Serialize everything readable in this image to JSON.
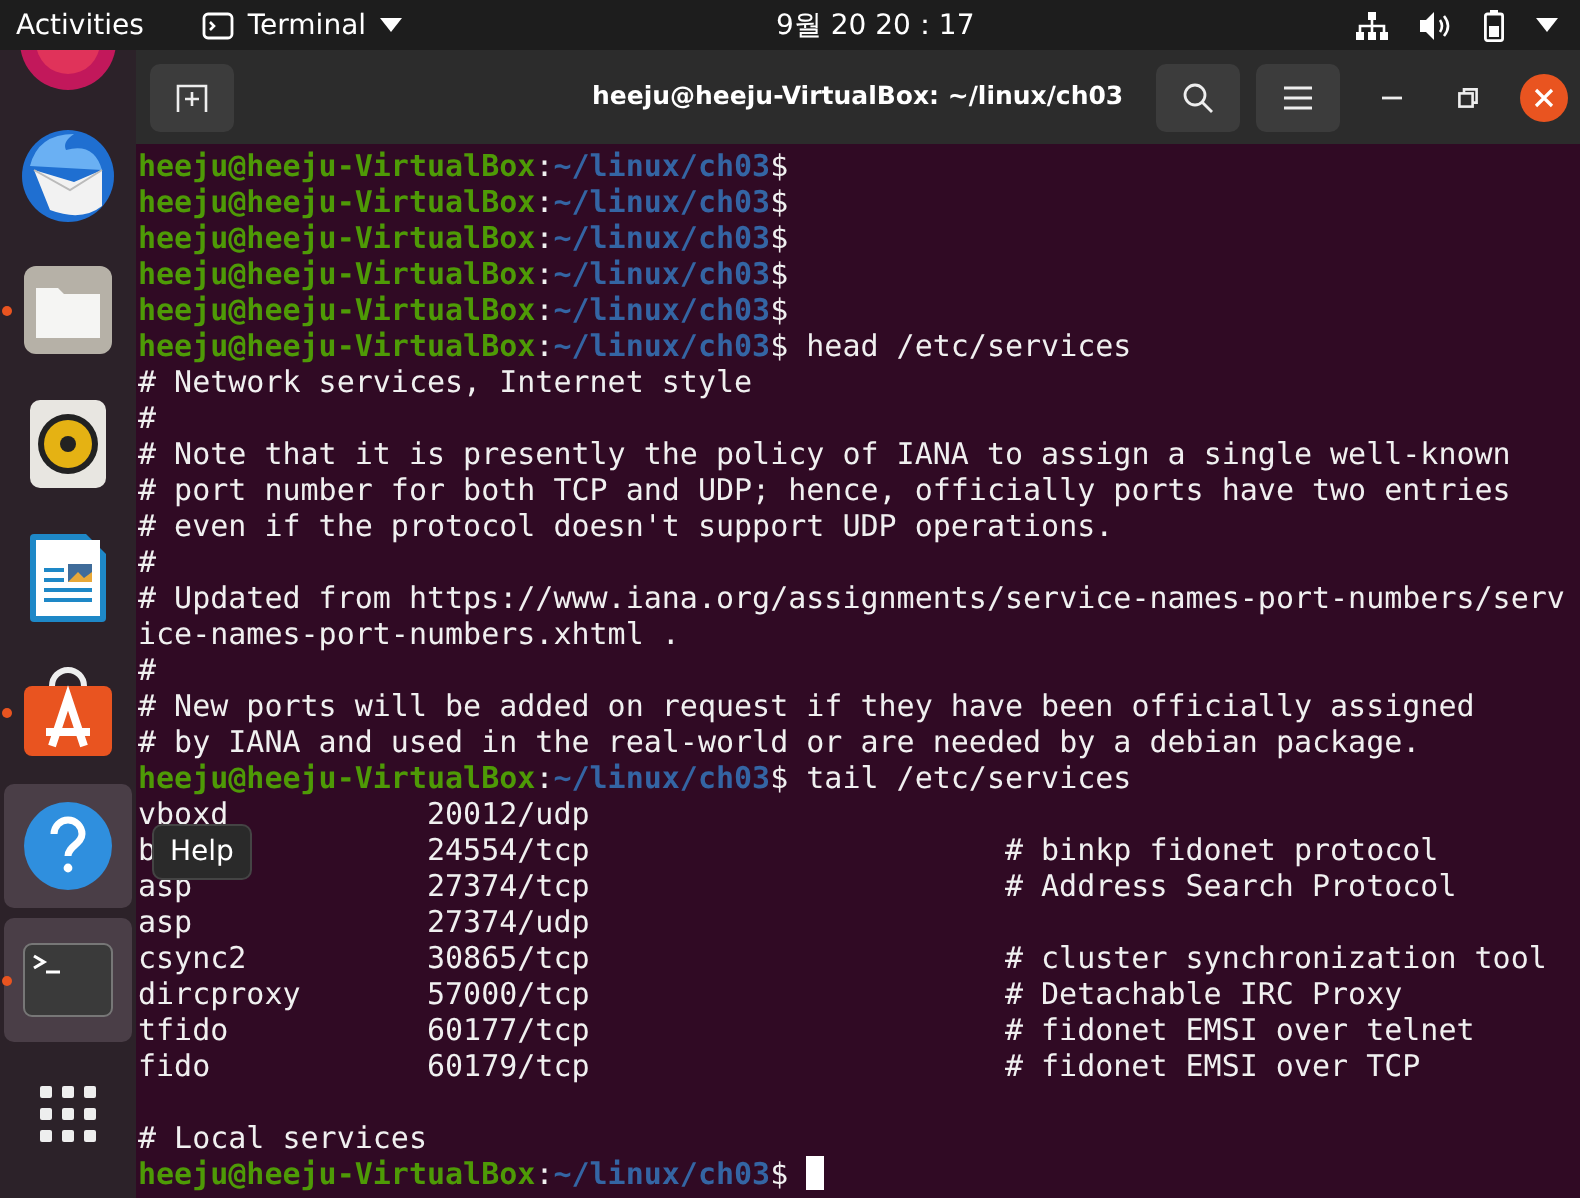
{
  "top_bar": {
    "activities": "Activities",
    "app_menu": "Terminal",
    "clock": "9월 20  20：17"
  },
  "dock": {
    "items": [
      {
        "kind": "round-red",
        "running": false,
        "highlighted": false
      },
      {
        "kind": "mail",
        "running": false,
        "highlighted": false
      },
      {
        "kind": "files",
        "running": true,
        "highlighted": false
      },
      {
        "kind": "speaker",
        "running": false,
        "highlighted": false
      },
      {
        "kind": "document",
        "running": false,
        "highlighted": false
      },
      {
        "kind": "store",
        "running": true,
        "highlighted": false
      },
      {
        "kind": "help",
        "running": false,
        "highlighted": true
      },
      {
        "kind": "terminal",
        "running": true,
        "highlighted": true
      },
      {
        "kind": "grid",
        "running": false,
        "highlighted": false
      }
    ],
    "tooltip": "Help"
  },
  "window": {
    "title": "heeju@heeju-VirtualBox: ~/linux/ch03"
  },
  "terminal": {
    "lines": [
      {
        "kind": "prompt",
        "user": "heeju@heeju-VirtualBox",
        "separator": ":",
        "path": "~/linux/ch03",
        "sign": "$"
      },
      {
        "kind": "prompt",
        "user": "heeju@heeju-VirtualBox",
        "separator": ":",
        "path": "~/linux/ch03",
        "sign": "$"
      },
      {
        "kind": "prompt",
        "user": "heeju@heeju-VirtualBox",
        "separator": ":",
        "path": "~/linux/ch03",
        "sign": "$"
      },
      {
        "kind": "prompt",
        "user": "heeju@heeju-VirtualBox",
        "separator": ":",
        "path": "~/linux/ch03",
        "sign": "$"
      },
      {
        "kind": "prompt",
        "user": "heeju@heeju-VirtualBox",
        "separator": ":",
        "path": "~/linux/ch03",
        "sign": "$"
      },
      {
        "kind": "prompt",
        "user": "heeju@heeju-VirtualBox",
        "separator": ":",
        "path": "~/linux/ch03",
        "sign": "$",
        "command": "head /etc/services"
      },
      {
        "kind": "text",
        "text": "# Network services, Internet style"
      },
      {
        "kind": "text",
        "text": "#"
      },
      {
        "kind": "text",
        "text": "# Note that it is presently the policy of IANA to assign a single well-known"
      },
      {
        "kind": "text",
        "text": "# port number for both TCP and UDP; hence, officially ports have two entries"
      },
      {
        "kind": "text",
        "text": "# even if the protocol doesn't support UDP operations."
      },
      {
        "kind": "text",
        "text": "#"
      },
      {
        "kind": "text",
        "text": "# Updated from https://www.iana.org/assignments/service-names-port-numbers/serv"
      },
      {
        "kind": "text",
        "text": "ice-names-port-numbers.xhtml ."
      },
      {
        "kind": "text",
        "text": "#"
      },
      {
        "kind": "text",
        "text": "# New ports will be added on request if they have been officially assigned"
      },
      {
        "kind": "text",
        "text": "# by IANA and used in the real-world or are needed by a debian package."
      },
      {
        "kind": "prompt",
        "user": "heeju@heeju-VirtualBox",
        "separator": ":",
        "path": "~/linux/ch03",
        "sign": "$",
        "command": "tail /etc/services"
      },
      {
        "kind": "service",
        "name": "vboxd",
        "port": "20012/udp"
      },
      {
        "kind": "service",
        "name": "b",
        "port": "24554/tcp",
        "comment": "# binkp fidonet protocol"
      },
      {
        "kind": "service",
        "name": "asp",
        "port": "27374/tcp",
        "comment": "# Address Search Protocol"
      },
      {
        "kind": "service",
        "name": "asp",
        "port": "27374/udp"
      },
      {
        "kind": "service",
        "name": "csync2",
        "port": "30865/tcp",
        "comment": "# cluster synchronization tool"
      },
      {
        "kind": "service",
        "name": "dircproxy",
        "port": "57000/tcp",
        "comment": "# Detachable IRC Proxy"
      },
      {
        "kind": "service",
        "name": "tfido",
        "port": "60177/tcp",
        "comment": "# fidonet EMSI over telnet"
      },
      {
        "kind": "service",
        "name": "fido",
        "port": "60179/tcp",
        "comment": "# fidonet EMSI over TCP"
      },
      {
        "kind": "blank"
      },
      {
        "kind": "text",
        "text": "# Local services"
      },
      {
        "kind": "prompt",
        "user": "heeju@heeju-VirtualBox",
        "separator": ":",
        "path": "~/linux/ch03",
        "sign": "$",
        "cursor": true
      }
    ]
  }
}
